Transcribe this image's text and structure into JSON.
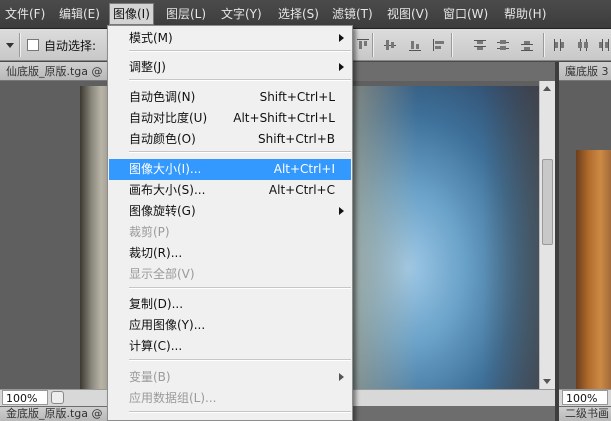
{
  "menubar": {
    "items": [
      {
        "label": "文件(F)"
      },
      {
        "label": "编辑(E)"
      },
      {
        "label": "图像(I)",
        "active": true
      },
      {
        "label": "图层(L)"
      },
      {
        "label": "文字(Y)"
      },
      {
        "label": "选择(S)"
      },
      {
        "label": "滤镜(T)"
      },
      {
        "label": "视图(V)"
      },
      {
        "label": "窗口(W)"
      },
      {
        "label": "帮助(H)"
      }
    ]
  },
  "options_bar": {
    "auto_select_label": "自动选择:",
    "auto_select_checked": false,
    "align_icons": [
      "align-top-icon",
      "align-vcenter-icon",
      "align-bottom-icon",
      "align-left-icon",
      "align-hcenter-icon",
      "align-right-icon",
      "distribute-top-icon",
      "distribute-vcenter-icon",
      "distribute-bottom-icon",
      "distribute-left-icon",
      "distribute-hcenter-icon",
      "distribute-right-icon"
    ]
  },
  "documents": {
    "tab_left": "仙底版_原版.tga @",
    "tab_right": "魔底版 3",
    "zoom_left": "100%",
    "zoom_right": "100%",
    "bottom_tab_left": "金底版_原版.tga @",
    "bottom_tab_right": "二级书画"
  },
  "image_menu": {
    "items": [
      {
        "label": "模式(M)",
        "submenu": true
      },
      {
        "separator": true
      },
      {
        "label": "调整(J)",
        "submenu": true
      },
      {
        "separator": true
      },
      {
        "label": "自动色调(N)",
        "shortcut": "Shift+Ctrl+L"
      },
      {
        "label": "自动对比度(U)",
        "shortcut": "Alt+Shift+Ctrl+L"
      },
      {
        "label": "自动颜色(O)",
        "shortcut": "Shift+Ctrl+B"
      },
      {
        "separator": true
      },
      {
        "label": "图像大小(I)...",
        "shortcut": "Alt+Ctrl+I",
        "highlighted": true
      },
      {
        "label": "画布大小(S)...",
        "shortcut": "Alt+Ctrl+C"
      },
      {
        "label": "图像旋转(G)",
        "submenu": true
      },
      {
        "label": "裁剪(P)",
        "disabled": true
      },
      {
        "label": "裁切(R)..."
      },
      {
        "label": "显示全部(V)",
        "disabled": true
      },
      {
        "separator": true
      },
      {
        "label": "复制(D)..."
      },
      {
        "label": "应用图像(Y)..."
      },
      {
        "label": "计算(C)..."
      },
      {
        "separator": true
      },
      {
        "label": "变量(B)",
        "submenu": true,
        "disabled": true
      },
      {
        "label": "应用数据组(L)...",
        "disabled": true
      },
      {
        "separator": true
      }
    ]
  },
  "colors": {
    "highlight": "#3399ff",
    "menubar": "#434343",
    "menu_bg": "#f0f0f0"
  }
}
